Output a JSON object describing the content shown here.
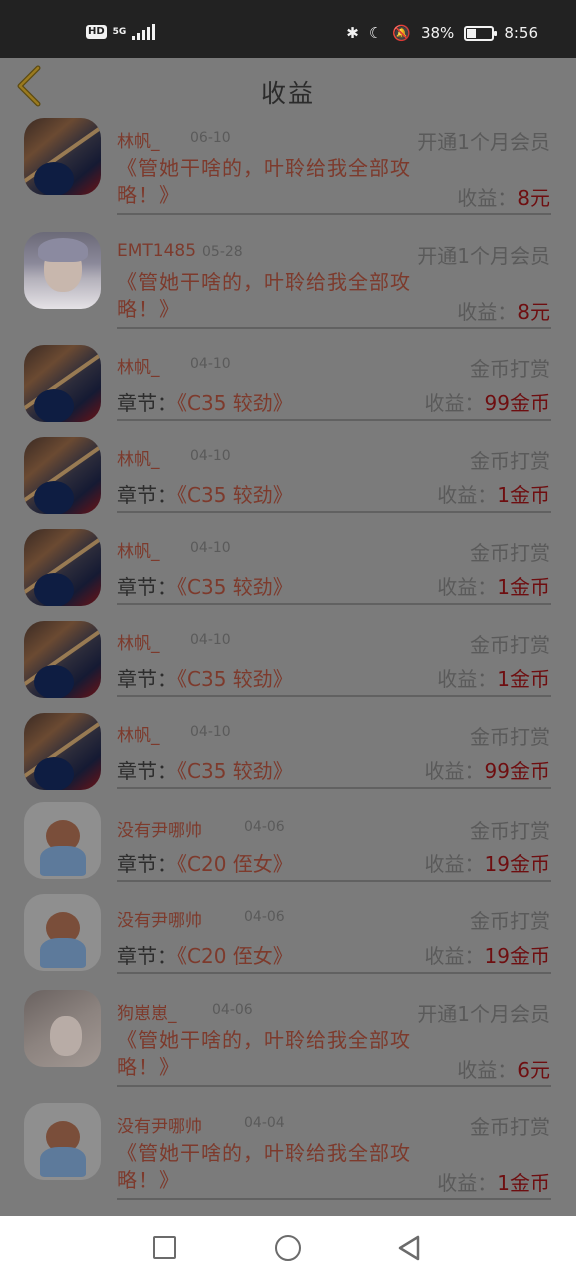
{
  "status_bar": {
    "hd": "HD",
    "network": "5G",
    "battery_text": "38%",
    "battery_level": 0.38,
    "time": "8:56",
    "icons": [
      "bluetooth-icon",
      "moon-icon",
      "mute-bell-icon"
    ]
  },
  "header": {
    "title": "收益",
    "back_icon": "chevron-left-icon"
  },
  "rows": [
    {
      "name": "林帆_",
      "date": "06-10",
      "type": "开通1个月会员",
      "desc": "《管她干啥的，叶聆给我全部攻略！》",
      "earn_label": "收益：",
      "earn_value": "8元",
      "avatar": "guitar"
    },
    {
      "name": "EMT1485",
      "date": "05-28",
      "type": "开通1个月会员",
      "desc": "《管她干啥的，叶聆给我全部攻略！》",
      "earn_label": "收益：",
      "earn_value": "8元",
      "avatar": "man"
    },
    {
      "name": "林帆_",
      "date": "04-10",
      "type": "金币打赏",
      "chapter_label": "章节：",
      "chapter": "《C35 较劲》",
      "earn_label": "收益：",
      "earn_value": "99金币",
      "avatar": "guitar"
    },
    {
      "name": "林帆_",
      "date": "04-10",
      "type": "金币打赏",
      "chapter_label": "章节：",
      "chapter": "《C35 较劲》",
      "earn_label": "收益：",
      "earn_value": "1金币",
      "avatar": "guitar"
    },
    {
      "name": "林帆_",
      "date": "04-10",
      "type": "金币打赏",
      "chapter_label": "章节：",
      "chapter": "《C35 较劲》",
      "earn_label": "收益：",
      "earn_value": "1金币",
      "avatar": "guitar"
    },
    {
      "name": "林帆_",
      "date": "04-10",
      "type": "金币打赏",
      "chapter_label": "章节：",
      "chapter": "《C35 较劲》",
      "earn_label": "收益：",
      "earn_value": "1金币",
      "avatar": "guitar"
    },
    {
      "name": "林帆_",
      "date": "04-10",
      "type": "金币打赏",
      "chapter_label": "章节：",
      "chapter": "《C35 较劲》",
      "earn_label": "收益：",
      "earn_value": "99金币",
      "avatar": "guitar"
    },
    {
      "name": "没有尹哪帅",
      "date": "04-06",
      "type": "金币打赏",
      "chapter_label": "章节：",
      "chapter": "《C20 侄女》",
      "earn_label": "收益：",
      "earn_value": "19金币",
      "avatar": "cartoon"
    },
    {
      "name": "没有尹哪帅",
      "date": "04-06",
      "type": "金币打赏",
      "chapter_label": "章节：",
      "chapter": "《C20 侄女》",
      "earn_label": "收益：",
      "earn_value": "19金币",
      "avatar": "cartoon"
    },
    {
      "name": "狗崽崽_",
      "date": "04-06",
      "type": "开通1个月会员",
      "desc": "《管她干啥的，叶聆给我全部攻略！》",
      "earn_label": "收益：",
      "earn_value": "6元",
      "avatar": "hand"
    },
    {
      "name": "没有尹哪帅",
      "date": "04-04",
      "type": "金币打赏",
      "desc": "《管她干啥的，叶聆给我全部攻略！》",
      "earn_label": "收益：",
      "earn_value": "1金币",
      "avatar": "cartoon"
    }
  ],
  "nav_bar": {
    "icons": [
      "recent-apps-icon",
      "home-icon",
      "back-icon"
    ]
  }
}
